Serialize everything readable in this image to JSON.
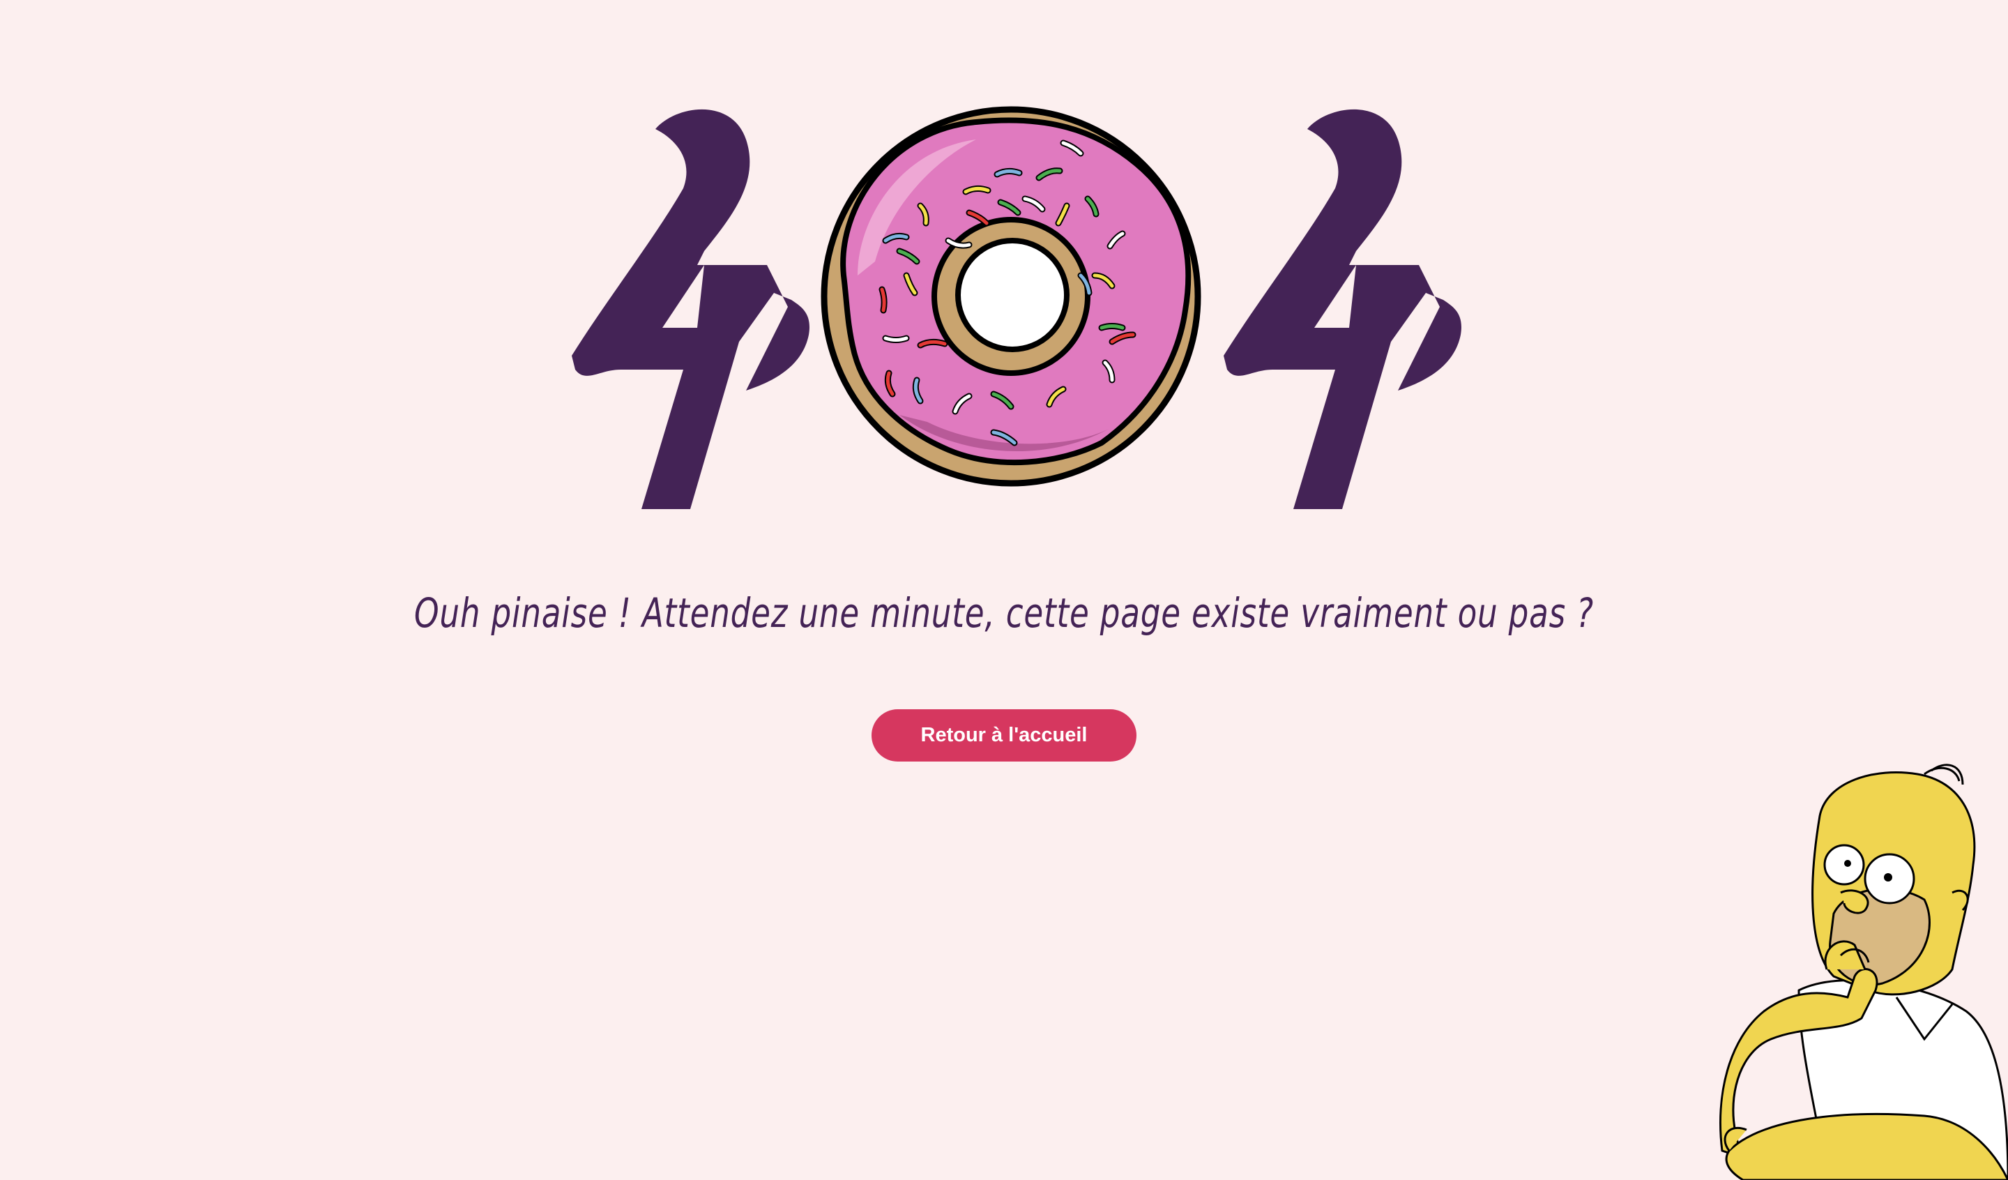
{
  "error_code": {
    "first_digit": "4",
    "middle_symbol": "donut-icon",
    "last_digit": "4",
    "color": "#442356"
  },
  "message": "Ouh pinaise ! Attendez une minute, cette page existe vraiment ou pas ?",
  "home_button": {
    "label": "Retour à l'accueil",
    "color": "#d6375f"
  },
  "illustration": "homer-thinking-icon",
  "colors": {
    "background": "#fcefef",
    "accent": "#d6375f",
    "text": "#442356",
    "icing": "#e07abf",
    "dough": "#c9a46f"
  }
}
